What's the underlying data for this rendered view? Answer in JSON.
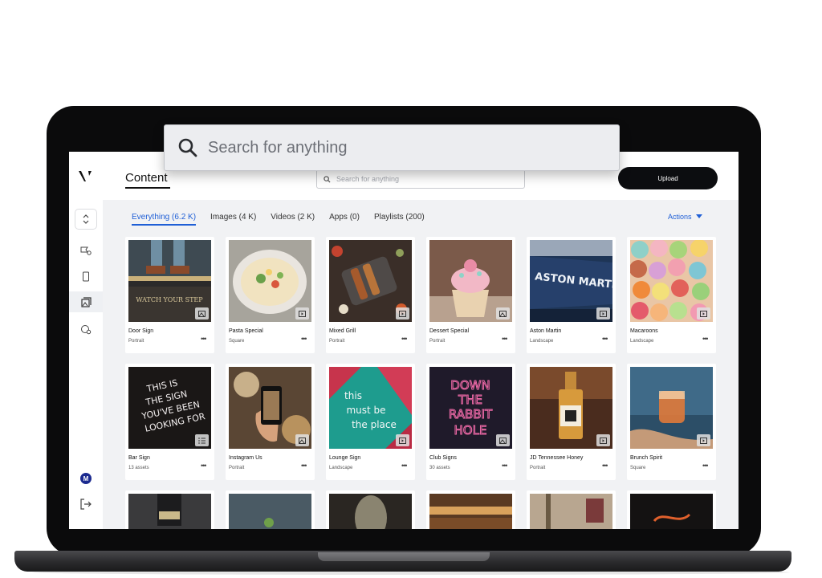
{
  "search": {
    "placeholder": "Search for anything"
  },
  "header": {
    "title": "Content",
    "search_placeholder": "Search for anything",
    "upload_label": "Upload"
  },
  "sidebar": {
    "avatar_initial": "M"
  },
  "tabs": [
    {
      "label": "Everything (6.2 K)",
      "active": true
    },
    {
      "label": "Images (4 K)"
    },
    {
      "label": "Videos (2 K)"
    },
    {
      "label": "Apps (0)"
    },
    {
      "label": "Playlists (200)"
    }
  ],
  "actions_label": "Actions",
  "cards": [
    {
      "title": "Door Sign",
      "subtitle": "Portrait",
      "type": "image-icon"
    },
    {
      "title": "Pasta Special",
      "subtitle": "Square",
      "type": "video-icon"
    },
    {
      "title": "Mixed Grill",
      "subtitle": "Portrait",
      "type": "video-icon"
    },
    {
      "title": "Dessert Special",
      "subtitle": "Portrait",
      "type": "image-icon"
    },
    {
      "title": "Aston Martin",
      "subtitle": "Landscape",
      "type": "video-icon"
    },
    {
      "title": "Macaroons",
      "subtitle": "Landscape",
      "type": "video-icon"
    },
    {
      "title": "Bar Sign",
      "subtitle": "13 assets",
      "type": "playlist-icon"
    },
    {
      "title": "Instagram Us",
      "subtitle": "Portrait",
      "type": "image-icon"
    },
    {
      "title": "Lounge Sign",
      "subtitle": "Landscape",
      "type": "video-icon"
    },
    {
      "title": "Club Signs",
      "subtitle": "30 assets",
      "type": "image-icon"
    },
    {
      "title": "JD Tennessee Honey",
      "subtitle": "Portrait",
      "type": "video-icon"
    },
    {
      "title": "Brunch Spirit",
      "subtitle": "Square",
      "type": "video-icon"
    }
  ],
  "thumb_texts": {
    "door_sign": "WATCH YOUR STEP",
    "aston": "ASTON MARTIN",
    "bar_sign": [
      "THIS IS",
      "THE SIGN",
      "YOU'VE BEEN",
      "LOOKING FOR"
    ],
    "lounge": [
      "this",
      "must be",
      "the place"
    ],
    "club": [
      "DOWN",
      "THE",
      "RABBIT",
      "HOLE"
    ]
  },
  "more_label": "•••"
}
